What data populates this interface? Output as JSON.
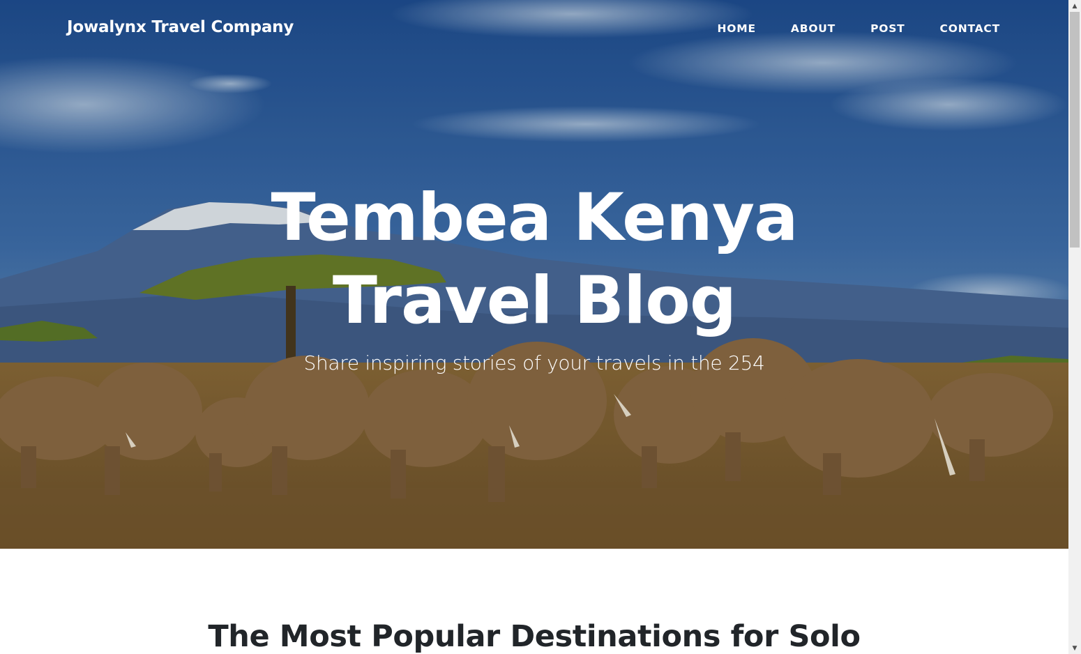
{
  "brand": "Jowalynx Travel Company",
  "nav": {
    "items": [
      "HOME",
      "ABOUT",
      "POST",
      "CONTACT"
    ]
  },
  "hero": {
    "title_line1": "Tembea Kenya",
    "title_line2": "Travel Blog",
    "subtitle": "Share inspiring stories of your travels in the 254"
  },
  "content": {
    "post_title": "The Most Popular Destinations for Solo"
  },
  "scrollbar": {
    "up_glyph": "▲",
    "down_glyph": "▼"
  },
  "colors": {
    "text_on_hero": "#ffffff",
    "heading_dark": "#212529",
    "sky": "#2d5f9f",
    "savanna": "#8a6a3a"
  },
  "icons": {
    "scroll_up": "scroll-up-arrow-icon",
    "scroll_down": "scroll-down-arrow-icon"
  }
}
